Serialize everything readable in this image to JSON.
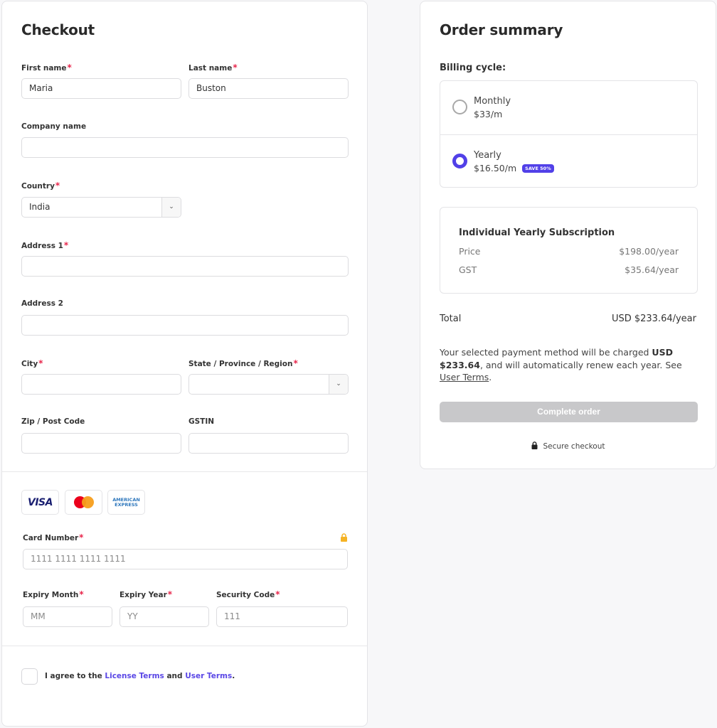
{
  "checkout": {
    "title": "Checkout",
    "fields": {
      "first_name": {
        "label": "First name",
        "value": "Maria",
        "required": true
      },
      "last_name": {
        "label": "Last name",
        "value": "Buston",
        "required": true
      },
      "company": {
        "label": "Company name",
        "value": ""
      },
      "country": {
        "label": "Country",
        "value": "India",
        "required": true
      },
      "address1": {
        "label": "Address 1",
        "value": "",
        "required": true
      },
      "address2": {
        "label": "Address 2",
        "value": ""
      },
      "city": {
        "label": "City",
        "value": "",
        "required": true
      },
      "state": {
        "label": "State / Province / Region",
        "value": "",
        "required": true
      },
      "zip": {
        "label": "Zip / Post Code",
        "value": ""
      },
      "gstin": {
        "label": "GSTIN",
        "value": ""
      }
    },
    "payment": {
      "logos": [
        "VISA",
        "Mastercard",
        "AMERICAN EXPRESS"
      ],
      "amex_line1": "AMERICAN",
      "amex_line2": "EXPRESS",
      "visa_text": "VISA",
      "card_number": {
        "label": "Card Number",
        "placeholder": "1111 1111 1111 1111"
      },
      "expiry_month": {
        "label": "Expiry Month",
        "placeholder": "MM"
      },
      "expiry_year": {
        "label": "Expiry Year",
        "placeholder": "YY"
      },
      "security_code": {
        "label": "Security Code",
        "placeholder": "111"
      }
    },
    "agree": {
      "prefix": "I agree to the ",
      "license_link": "License Terms",
      "middle": " and ",
      "user_link": "User Terms",
      "suffix": "."
    },
    "required_mark": "*"
  },
  "summary": {
    "title": "Order summary",
    "billing_label": "Billing cycle:",
    "options": [
      {
        "name": "Monthly",
        "price": "$33/m",
        "selected": false
      },
      {
        "name": "Yearly",
        "price": "$16.50/m",
        "badge": "SAVE 50%",
        "selected": true
      }
    ],
    "subscription": {
      "title": "Individual Yearly Subscription",
      "rows": [
        {
          "label": "Price",
          "value": "$198.00/year"
        },
        {
          "label": "GST",
          "value": "$35.64/year"
        }
      ]
    },
    "total": {
      "label": "Total",
      "value": "USD $233.64/year"
    },
    "note": {
      "prefix": "Your selected payment method will be charged ",
      "amount": "USD $233.64",
      "middle": ", and will automatically renew each year. See ",
      "link": "User Terms",
      "suffix": "."
    },
    "complete_button": "Complete order",
    "secure_text": "Secure checkout"
  },
  "colors": {
    "accent": "#5140e8",
    "required": "#e8264b",
    "disabled_button": "#c8c8ca",
    "lock_yellow": "#f5b324"
  }
}
